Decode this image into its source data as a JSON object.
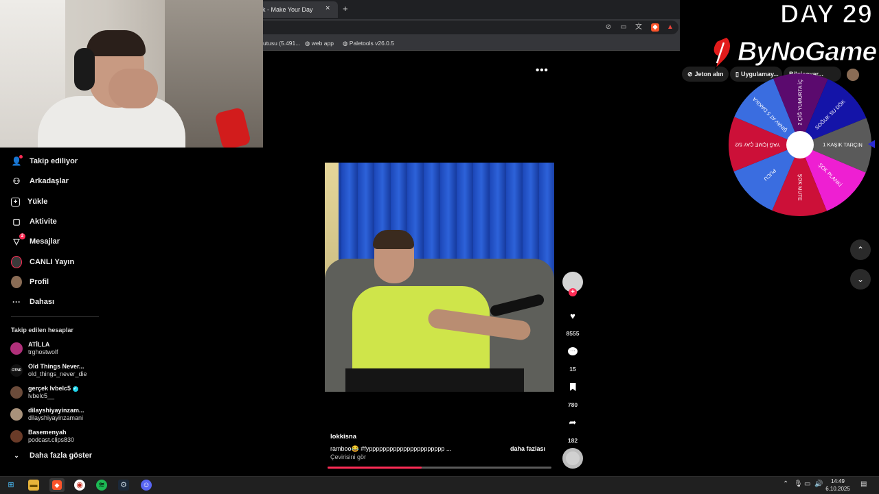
{
  "browser": {
    "tab_title": "k - Make Your Day",
    "tab_close": "×",
    "new_tab": "+",
    "bookmarks": [
      {
        "label": "utusu (5.491..."
      },
      {
        "label": "web app"
      },
      {
        "label": "Paletools v26.0.5"
      }
    ]
  },
  "overlay": {
    "day_label": "DAY 29",
    "brand": "ByNoGame",
    "wheel_segments": [
      {
        "label": "2 ÇİĞ YUMURTA İÇ",
        "color": "#5b0a6e"
      },
      {
        "label": "SOĞUK SU DÖK",
        "color": "#1414a8"
      },
      {
        "label": "1 KAŞIK TARÇIN",
        "color": "#5a5a5a"
      },
      {
        "label": "ŞOK PLANKİ",
        "color": "#ee1fd2"
      },
      {
        "label": "ŞOK MUTE",
        "color": "#cc1038"
      },
      {
        "label": "PUCU",
        "color": "#3a6de0"
      },
      {
        "label": "YAĞ İÇME ÇAY 5/2",
        "color": "#cc1038"
      },
      {
        "label": "ŞINAV AT 5 DAKİKA",
        "color": "#3a6de0"
      }
    ]
  },
  "header": {
    "more_dots": "•••",
    "coins_button": "Jeton alın",
    "app_button": "Uygulamay...",
    "third_button": "Bilgisayar..."
  },
  "sidebar": {
    "items": [
      {
        "label": "Takip ediliyor",
        "icon": "following-icon"
      },
      {
        "label": "Arkadaşlar",
        "icon": "friends-icon"
      },
      {
        "label": "Yükle",
        "icon": "upload-icon"
      },
      {
        "label": "Aktivite",
        "icon": "activity-icon"
      },
      {
        "label": "Mesajlar",
        "icon": "messages-icon",
        "badge": "2"
      },
      {
        "label": "CANLI Yayın",
        "icon": "live-icon"
      },
      {
        "label": "Profil",
        "icon": "profile-icon"
      },
      {
        "label": "Dahası",
        "icon": "more-icon"
      }
    ],
    "followed_header": "Takip edilen hesaplar",
    "accounts": [
      {
        "name": "ATİLLA",
        "handle": "trghostwolf",
        "avatar_color": "#b0307a"
      },
      {
        "name": "Old Things Never...",
        "handle": "old_things_never_die",
        "avatar_color": "#222222",
        "avatar_text": "OTND"
      },
      {
        "name": "gerçek lvbelc5",
        "handle": "lvbelc5__",
        "avatar_color": "#6b4b3a",
        "verified": true
      },
      {
        "name": "dilayshiyayinzam...",
        "handle": "dilayshiyayinzamani",
        "avatar_color": "#a8927b"
      },
      {
        "name": "Basemenyah",
        "handle": "podcast.clips830",
        "avatar_color": "#6a3b28"
      }
    ],
    "show_more": "Daha fazla göster"
  },
  "video": {
    "author": "lokkisna",
    "caption": "ramboo😂 #fypppppppppppppppppppppp  ...",
    "more_link": "daha fazlası",
    "see_translation": "Çevirisini gör",
    "progress": 0.42,
    "likes": "8555",
    "comments": "15",
    "saves": "780",
    "shares": "182"
  },
  "taskbar": {
    "time": "14:49",
    "date": "6.10.2025"
  }
}
